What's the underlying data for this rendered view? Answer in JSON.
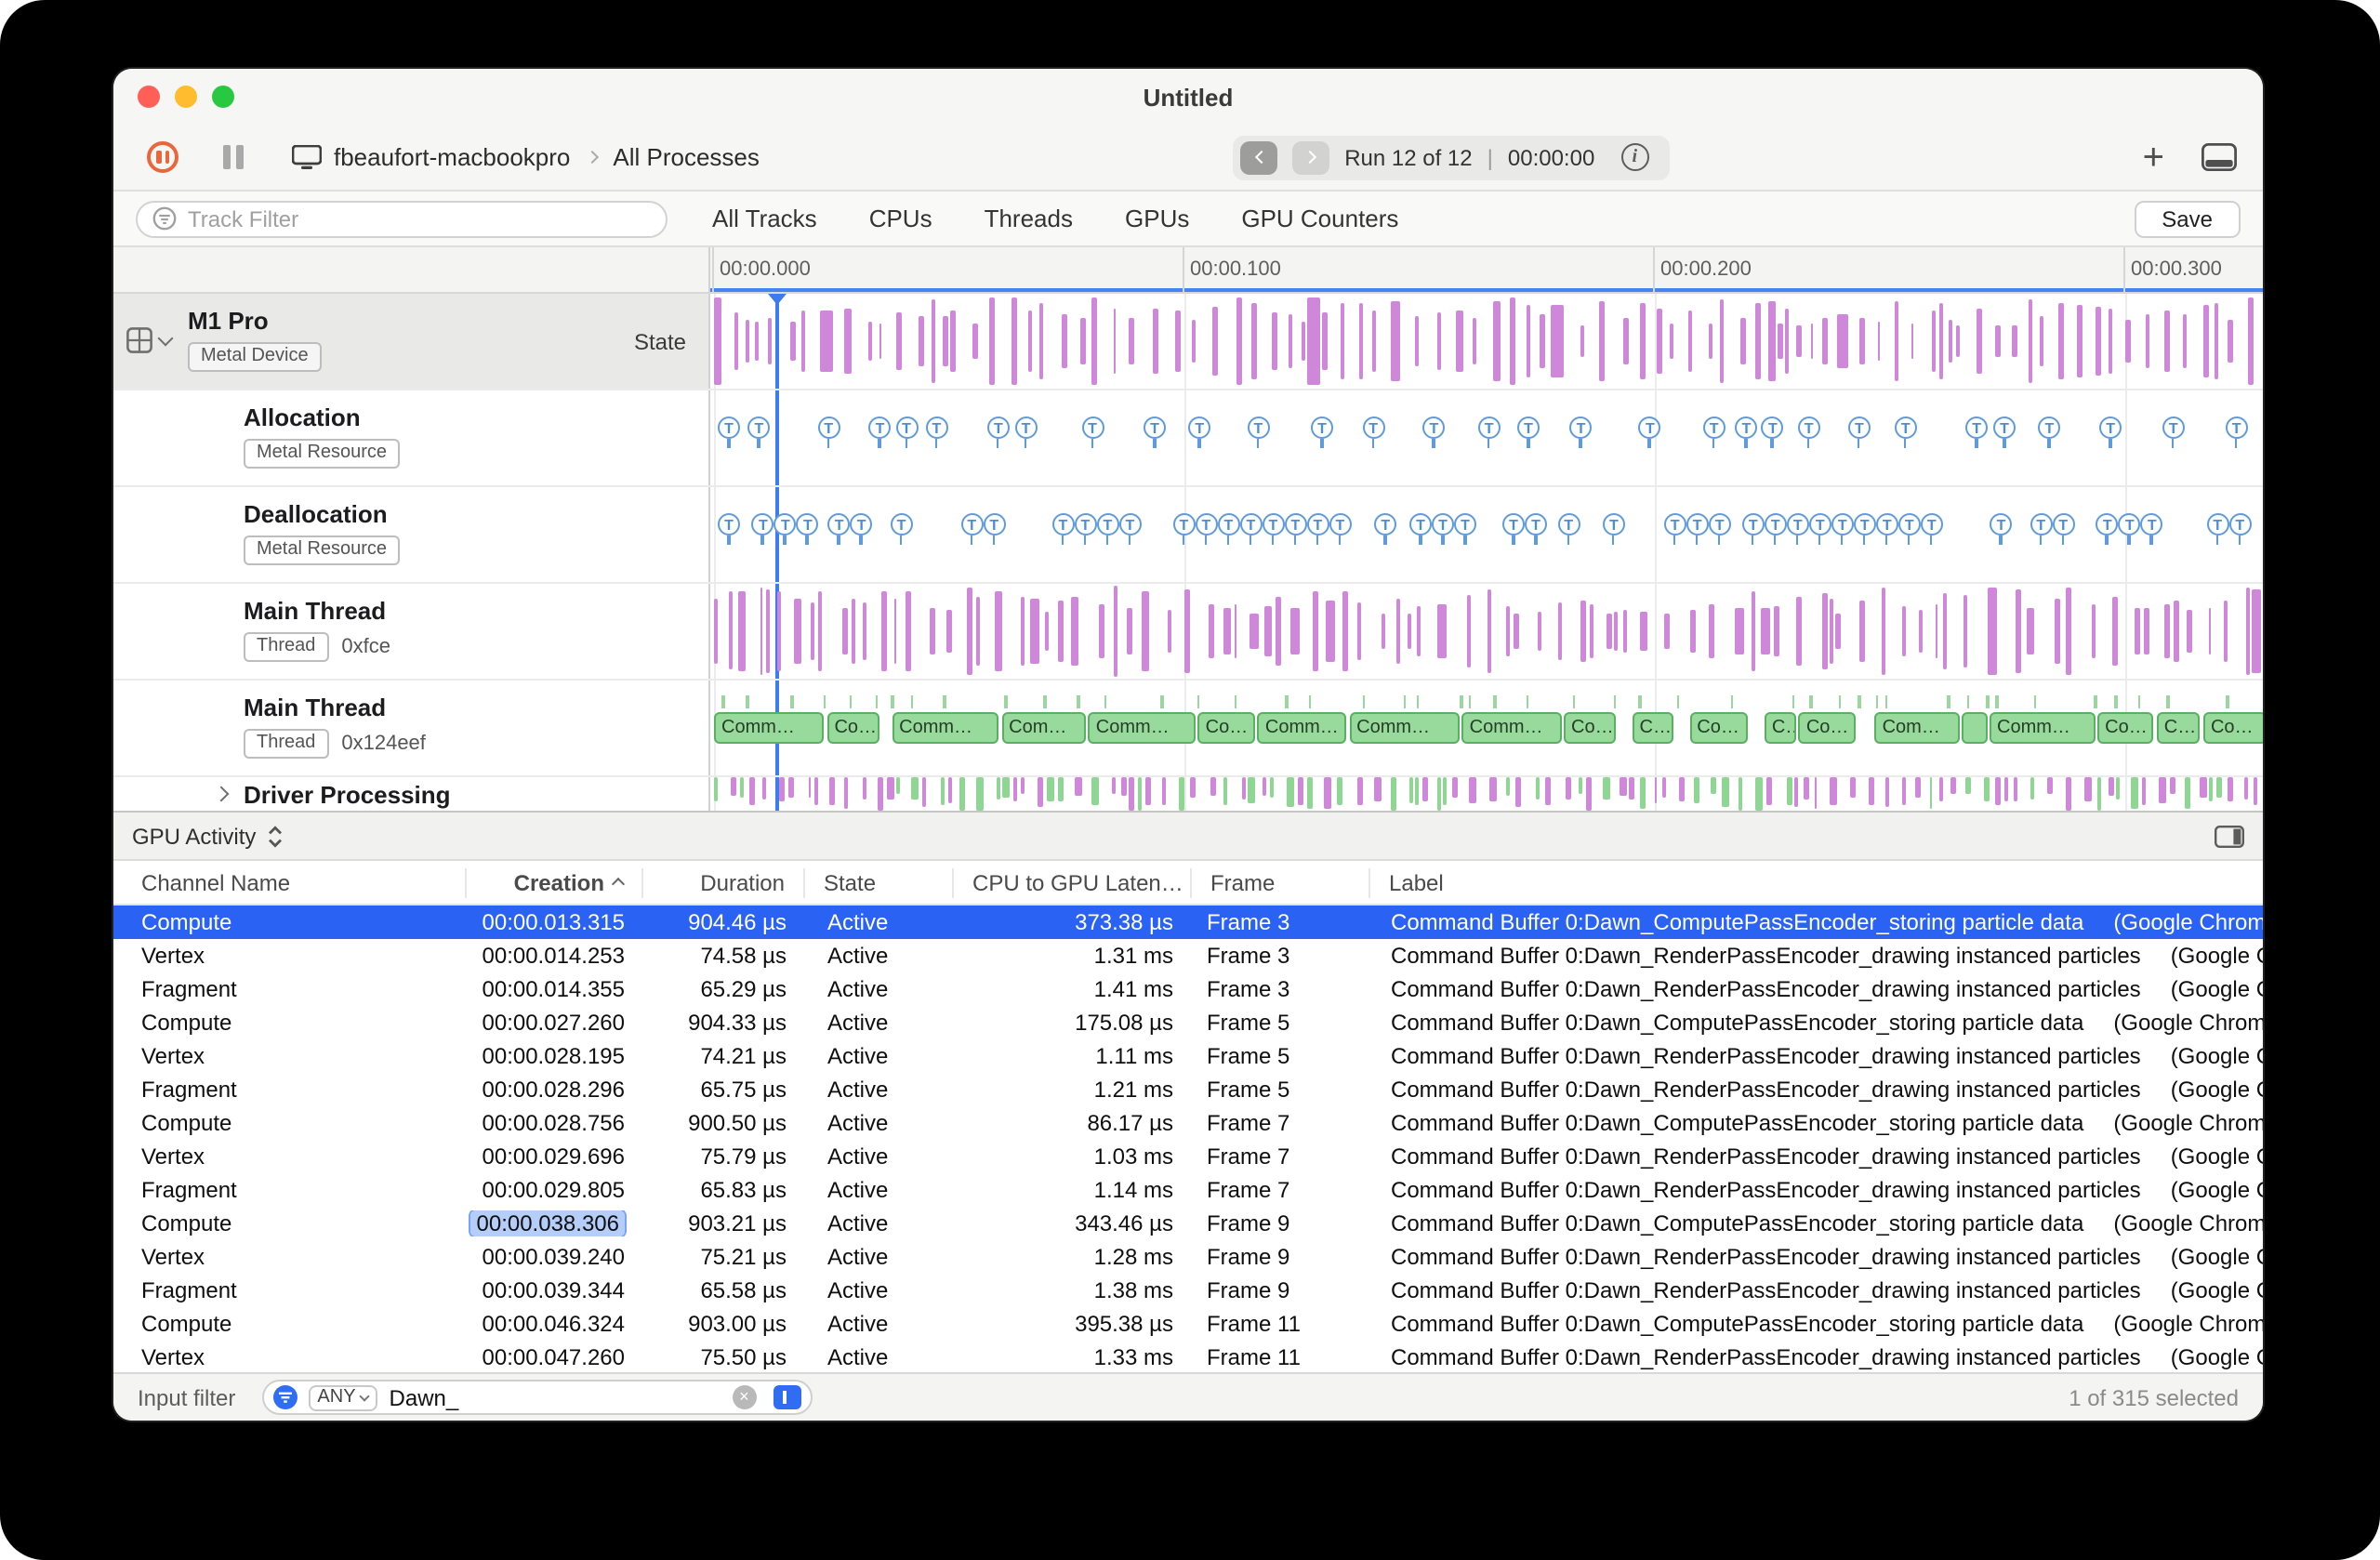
{
  "window": {
    "title": "Untitled"
  },
  "toolbar": {
    "device": "fbeaufort-macbookpro",
    "scope": "All Processes",
    "run_label": "Run 12 of 12",
    "divider": "|",
    "run_time": "00:00:00"
  },
  "filter_bar": {
    "placeholder": "Track Filter",
    "tabs": [
      "All Tracks",
      "CPUs",
      "Threads",
      "GPUs",
      "GPU Counters"
    ],
    "save_label": "Save"
  },
  "timeline": {
    "ticks": [
      "00:00.000",
      "00:00.100",
      "00:00.200",
      "00:00.300"
    ]
  },
  "tracks": [
    {
      "name": "M1 Pro",
      "tag": "Metal Device",
      "state_label": "State"
    },
    {
      "name": "Allocation",
      "tag": "Metal Resource"
    },
    {
      "name": "Deallocation",
      "tag": "Metal Resource"
    },
    {
      "name": "Main Thread",
      "tag": "Thread",
      "value": "0xfce"
    },
    {
      "name": "Main Thread",
      "tag": "Thread",
      "value": "0x124eef"
    },
    {
      "name": "Driver Processing"
    }
  ],
  "colors": {
    "purple": "#cf87da",
    "blue": "#4a90d9",
    "green": "#98d99c",
    "selection": "#2a62f4",
    "accent": "#3d7bf0"
  },
  "detail": {
    "selector": "GPU Activity",
    "columns": [
      "Channel Name",
      "Creation",
      "Duration",
      "State",
      "CPU to GPU Laten…",
      "Frame",
      "Label"
    ],
    "rows": [
      {
        "channel": "Compute",
        "creation": "00:00.013.315",
        "duration": "904.46 µs",
        "state": "Active",
        "latency": "373.38 µs",
        "frame": "Frame 3",
        "label": "Command Buffer 0:Dawn_ComputePassEncoder_storing particle data",
        "app": "(Google Chrome He",
        "selected": true
      },
      {
        "channel": "Vertex",
        "creation": "00:00.014.253",
        "duration": "74.58 µs",
        "state": "Active",
        "latency": "1.31 ms",
        "frame": "Frame 3",
        "label": "Command Buffer 0:Dawn_RenderPassEncoder_drawing instanced particles",
        "app": "(Google Chro"
      },
      {
        "channel": "Fragment",
        "creation": "00:00.014.355",
        "duration": "65.29 µs",
        "state": "Active",
        "latency": "1.41 ms",
        "frame": "Frame 3",
        "label": "Command Buffer 0:Dawn_RenderPassEncoder_drawing instanced particles",
        "app": "(Google Chro"
      },
      {
        "channel": "Compute",
        "creation": "00:00.027.260",
        "duration": "904.33 µs",
        "state": "Active",
        "latency": "175.08 µs",
        "frame": "Frame 5",
        "label": "Command Buffer 0:Dawn_ComputePassEncoder_storing particle data",
        "app": "(Google Chrome He"
      },
      {
        "channel": "Vertex",
        "creation": "00:00.028.195",
        "duration": "74.21 µs",
        "state": "Active",
        "latency": "1.11 ms",
        "frame": "Frame 5",
        "label": "Command Buffer 0:Dawn_RenderPassEncoder_drawing instanced particles",
        "app": "(Google Chro"
      },
      {
        "channel": "Fragment",
        "creation": "00:00.028.296",
        "duration": "65.75 µs",
        "state": "Active",
        "latency": "1.21 ms",
        "frame": "Frame 5",
        "label": "Command Buffer 0:Dawn_RenderPassEncoder_drawing instanced particles",
        "app": "(Google Chro"
      },
      {
        "channel": "Compute",
        "creation": "00:00.028.756",
        "duration": "900.50 µs",
        "state": "Active",
        "latency": "86.17 µs",
        "frame": "Frame 7",
        "label": "Command Buffer 0:Dawn_ComputePassEncoder_storing particle data",
        "app": "(Google Chrome He"
      },
      {
        "channel": "Vertex",
        "creation": "00:00.029.696",
        "duration": "75.79 µs",
        "state": "Active",
        "latency": "1.03 ms",
        "frame": "Frame 7",
        "label": "Command Buffer 0:Dawn_RenderPassEncoder_drawing instanced particles",
        "app": "(Google Chro"
      },
      {
        "channel": "Fragment",
        "creation": "00:00.029.805",
        "duration": "65.83 µs",
        "state": "Active",
        "latency": "1.14 ms",
        "frame": "Frame 7",
        "label": "Command Buffer 0:Dawn_RenderPassEncoder_drawing instanced particles",
        "app": "(Google Chro"
      },
      {
        "channel": "Compute",
        "creation": "00:00.038.306",
        "duration": "903.21 µs",
        "state": "Active",
        "latency": "343.46 µs",
        "frame": "Frame 9",
        "label": "Command Buffer 0:Dawn_ComputePassEncoder_storing particle data",
        "app": "(Google Chrome He",
        "highlight": true
      },
      {
        "channel": "Vertex",
        "creation": "00:00.039.240",
        "duration": "75.21 µs",
        "state": "Active",
        "latency": "1.28 ms",
        "frame": "Frame 9",
        "label": "Command Buffer 0:Dawn_RenderPassEncoder_drawing instanced particles",
        "app": "(Google Chro"
      },
      {
        "channel": "Fragment",
        "creation": "00:00.039.344",
        "duration": "65.58 µs",
        "state": "Active",
        "latency": "1.38 ms",
        "frame": "Frame 9",
        "label": "Command Buffer 0:Dawn_RenderPassEncoder_drawing instanced particles",
        "app": "(Google Chro"
      },
      {
        "channel": "Compute",
        "creation": "00:00.046.324",
        "duration": "903.00 µs",
        "state": "Active",
        "latency": "395.38 µs",
        "frame": "Frame 11",
        "label": "Command Buffer 0:Dawn_ComputePassEncoder_storing particle data",
        "app": "(Google Chrome He"
      },
      {
        "channel": "Vertex",
        "creation": "00:00.047.260",
        "duration": "75.50 µs",
        "state": "Active",
        "latency": "1.33 ms",
        "frame": "Frame 11",
        "label": "Command Buffer 0:Dawn_RenderPassEncoder_drawing instanced particles",
        "app": "(Google Chro"
      }
    ],
    "footer": {
      "label": "Input filter",
      "match": "ANY",
      "query": "Dawn_",
      "selection": "1 of 315 selected"
    }
  }
}
